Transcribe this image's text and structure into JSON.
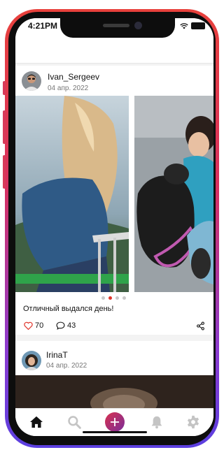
{
  "status_bar": {
    "time": "4:21PM"
  },
  "posts": [
    {
      "username": "Ivan_Sergeev",
      "date": "04 апр. 2022",
      "caption": "Отличный выдался день!",
      "likes": "70",
      "comments": "43",
      "carousel": {
        "count": 4,
        "active": 1
      }
    },
    {
      "username": "IrinaT",
      "date": "04 апр. 2022"
    }
  ],
  "bottom_nav": [
    "home-icon",
    "search-icon",
    "add-icon",
    "bell-icon",
    "gear-icon"
  ],
  "colors": {
    "accent_red": "#e0352b",
    "frame_top": "#e8413c",
    "frame_bottom": "#5b3fe0",
    "add_button": "#b52d73",
    "nav_inactive": "#c4c4c4",
    "nav_active": "#111111"
  }
}
